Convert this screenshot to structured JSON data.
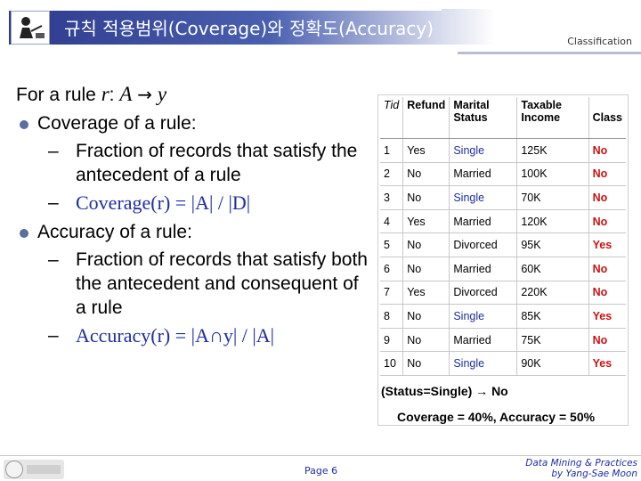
{
  "header": {
    "title": "규칙 적용범위(Coverage)와 정확도(Accuracy)",
    "category": "Classification"
  },
  "content": {
    "intro_prefix": "For a rule ",
    "intro_rule": "r",
    "intro_colon": ": ",
    "intro_antecedent": "A",
    "intro_arrow": "→",
    "intro_consequent": "y",
    "coverage_heading": "Coverage of a rule:",
    "coverage_desc": "Fraction of records that satisfy the antecedent of a rule",
    "coverage_formula": "Coverage(r) = |A| / |D|",
    "accuracy_heading": "Accuracy of a rule:",
    "accuracy_desc": "Fraction of records that satisfy both the antecedent and consequent of a rule",
    "accuracy_formula": "Accuracy(r) = |A∩y| / |A|"
  },
  "table": {
    "headers": [
      "Tid",
      "Refund",
      "Marital Status",
      "Taxable Income",
      "Class"
    ],
    "rows": [
      [
        "1",
        "Yes",
        "Single",
        "125K",
        "No"
      ],
      [
        "2",
        "No",
        "Married",
        "100K",
        "No"
      ],
      [
        "3",
        "No",
        "Single",
        "70K",
        "No"
      ],
      [
        "4",
        "Yes",
        "Married",
        "120K",
        "No"
      ],
      [
        "5",
        "No",
        "Divorced",
        "95K",
        "Yes"
      ],
      [
        "6",
        "No",
        "Married",
        "60K",
        "No"
      ],
      [
        "7",
        "Yes",
        "Divorced",
        "220K",
        "No"
      ],
      [
        "8",
        "No",
        "Single",
        "85K",
        "Yes"
      ],
      [
        "9",
        "No",
        "Married",
        "75K",
        "No"
      ],
      [
        "10",
        "No",
        "Single",
        "90K",
        "Yes"
      ]
    ]
  },
  "example": {
    "rule": "(Status=Single) → No",
    "metrics": "Coverage = 40%, Accuracy = 50%"
  },
  "footer": {
    "page": "Page 6",
    "credit_line1": "Data Mining & Practices",
    "credit_line2": "by Yang-Sae Moon"
  }
}
